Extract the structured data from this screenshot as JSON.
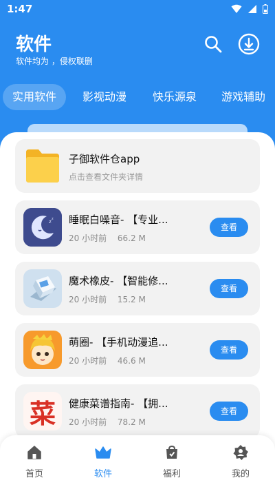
{
  "status_bar": {
    "time": "1:47"
  },
  "header": {
    "title": "软件",
    "subtitle": "软件均为       ，侵权联删"
  },
  "tabs": [
    {
      "label": "实用软件",
      "active": true
    },
    {
      "label": "影视动漫",
      "active": false
    },
    {
      "label": "快乐源泉",
      "active": false
    },
    {
      "label": "游戏辅助",
      "active": false
    }
  ],
  "folder": {
    "name": "子御软件仓app",
    "description": "点击查看文件夹详情"
  },
  "apps": [
    {
      "name": "睡眠白噪音-          【专业...",
      "time": "20 小时前",
      "size": "66.2 M",
      "button": "查看",
      "icon": "moon-sleep-icon"
    },
    {
      "name": "魔术橡皮-           【智能修...",
      "time": "20 小时前",
      "size": "15.2 M",
      "button": "查看",
      "icon": "eraser-icon"
    },
    {
      "name": "萌圈-      【手机动漫追...",
      "time": "20 小时前",
      "size": "46.6 M",
      "button": "查看",
      "icon": "anime-avatar-icon"
    },
    {
      "name": "健康菜谱指南-         【拥...",
      "time": "20 小时前",
      "size": "78.2 M",
      "button": "查看",
      "icon": "recipe-icon",
      "icon_text": "菜"
    }
  ],
  "bottom_nav": [
    {
      "label": "首页",
      "icon": "home-icon",
      "active": false
    },
    {
      "label": "软件",
      "icon": "crown-icon",
      "active": true
    },
    {
      "label": "福利",
      "icon": "gift-bag-icon",
      "active": false
    },
    {
      "label": "我的",
      "icon": "user-icon",
      "active": false
    }
  ],
  "colors": {
    "primary": "#2a8cf0",
    "card_bg": "#f2f2f2",
    "folder": "#fcc93b"
  }
}
